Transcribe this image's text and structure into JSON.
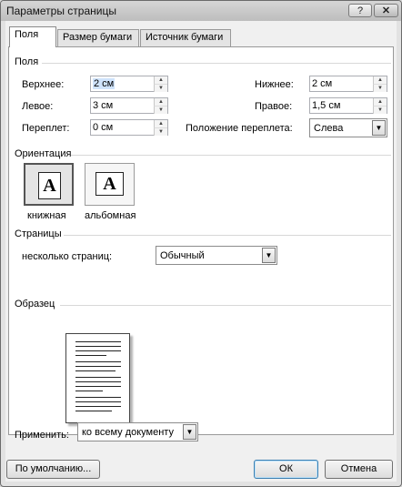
{
  "window": {
    "title": "Параметры страницы",
    "help": "?",
    "close": "✕"
  },
  "tabs": [
    {
      "label": "Поля",
      "active": true
    },
    {
      "label": "Размер бумаги",
      "active": false
    },
    {
      "label": "Источник бумаги",
      "active": false
    }
  ],
  "margins": {
    "section": "Поля",
    "top_label": "Верхнее:",
    "top_value": "2 см",
    "bottom_label": "Нижнее:",
    "bottom_value": "2 см",
    "left_label": "Левое:",
    "left_value": "3 см",
    "right_label": "Правое:",
    "right_value": "1,5 см",
    "gutter_label": "Переплет:",
    "gutter_value": "0 см",
    "gutter_pos_label": "Положение переплета:",
    "gutter_pos_value": "Слева"
  },
  "orientation": {
    "section": "Ориентация",
    "portrait_label": "книжная",
    "landscape_label": "альбомная",
    "icon_letter": "A",
    "selected": "portrait"
  },
  "pages": {
    "section": "Страницы",
    "multiple_label": "несколько страниц:",
    "multiple_value": "Обычный"
  },
  "preview": {
    "section": "Образец"
  },
  "apply": {
    "label": "Применить:",
    "value": "ко всему документу"
  },
  "buttons": {
    "default": "По умолчанию...",
    "ok": "ОК",
    "cancel": "Отмена"
  }
}
